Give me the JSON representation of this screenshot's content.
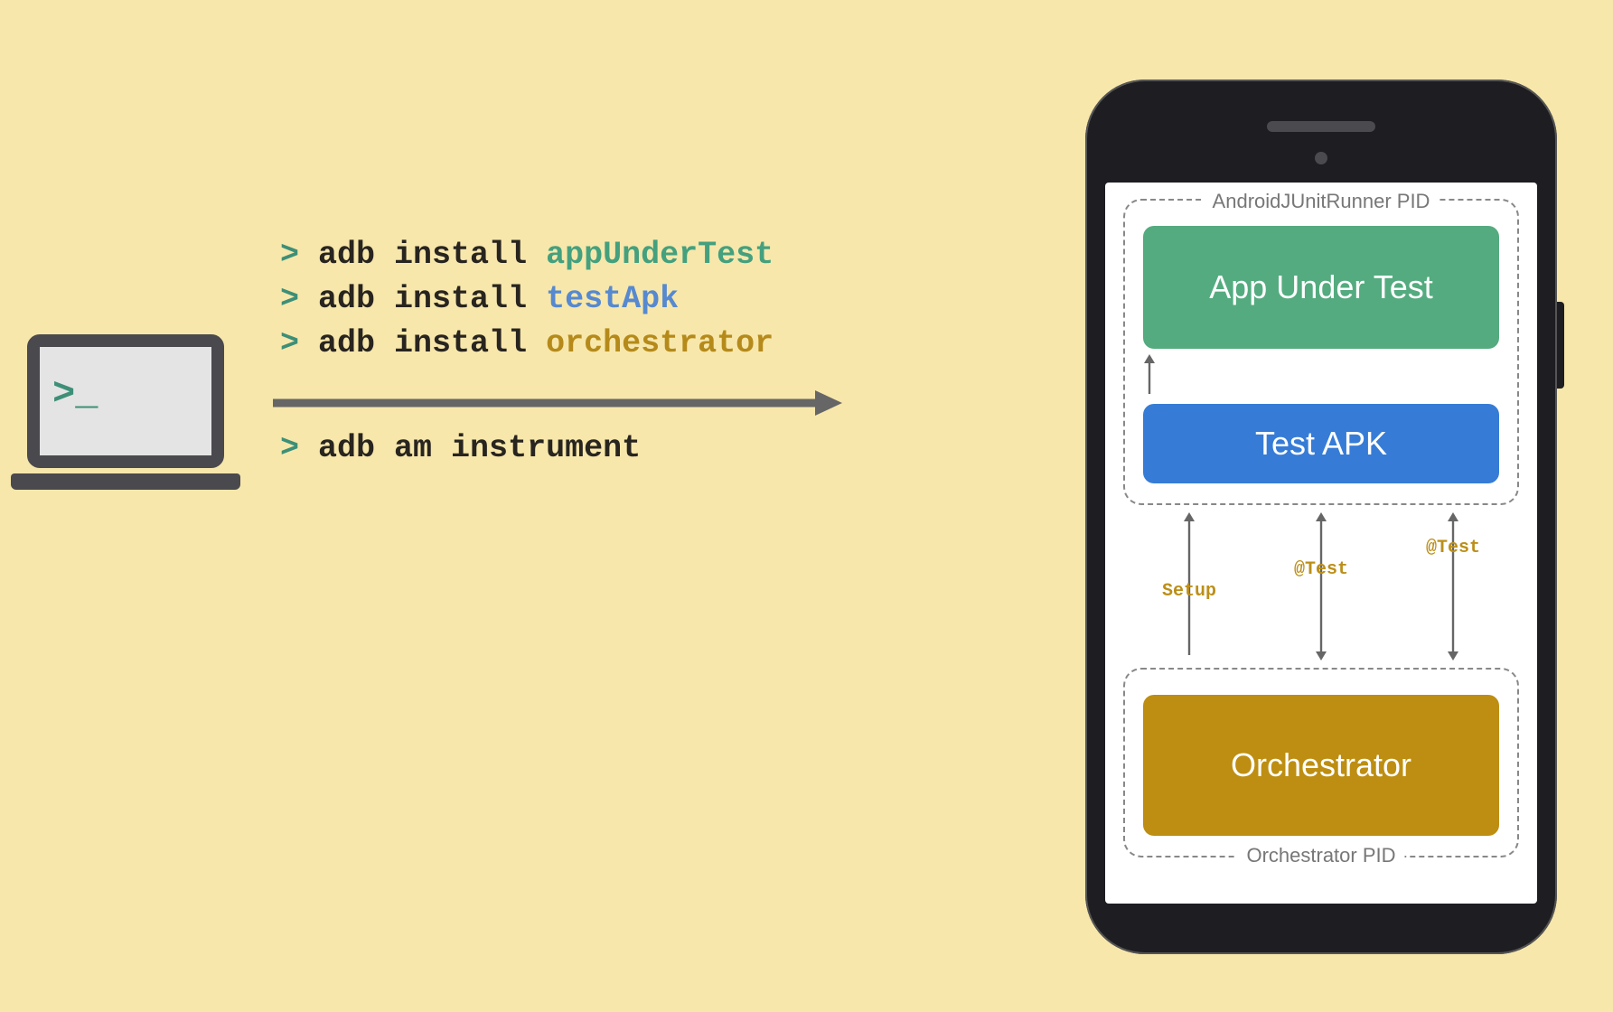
{
  "laptop": {
    "prompt": ">_"
  },
  "commands": {
    "line1": {
      "angle": ">",
      "cmd": "adb install",
      "arg": "appUnderTest"
    },
    "line2": {
      "angle": ">",
      "cmd": "adb install",
      "arg": "testApk"
    },
    "line3": {
      "angle": ">",
      "cmd": "adb install",
      "arg": "orchestrator"
    },
    "line4": {
      "angle": ">",
      "cmd": "adb am instrument"
    }
  },
  "phone": {
    "pid_top_label": "AndroidJUnitRunner PID",
    "app_under_test": "App Under Test",
    "test_apk": "Test APK",
    "inter": {
      "setup": "Setup",
      "test1": "@Test",
      "test2": "@Test"
    },
    "orchestrator": "Orchestrator",
    "pid_bottom_label": "Orchestrator PID"
  },
  "colors": {
    "bg": "#f7e7ab",
    "green": "#44a07e",
    "blue": "#367cd6",
    "gold": "#bd8e12"
  }
}
